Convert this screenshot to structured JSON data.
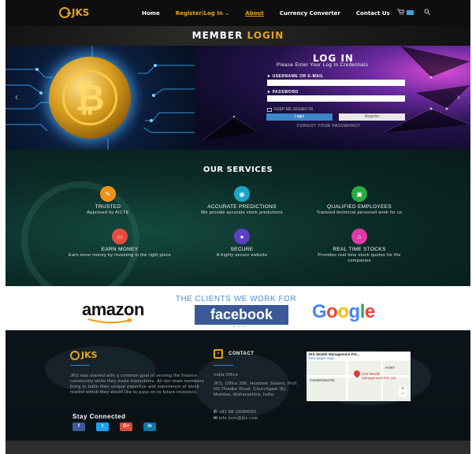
{
  "nav": {
    "logo": "JKS",
    "links": [
      "Home",
      "Register/Log In",
      "About",
      "Currency Converter",
      "Contact Us"
    ],
    "register_caret": "⌄"
  },
  "banner": {
    "title_white": "MEMBER",
    "title_gold": "LOGIN"
  },
  "login": {
    "title": "LOG IN",
    "subtitle": "Please Enter Your Log In Credentials",
    "username_label": "USERNAME OR E-MAIL",
    "password_label": "PASSWORD",
    "keep_signed": "KEEP ME SIGNED IN",
    "login_button": "Login",
    "register_button": "Register",
    "forgot": "FORGOT YOUR PASSWORD?"
  },
  "services": {
    "title": "OUR SERVICES",
    "items": [
      {
        "title": "TRUSTED",
        "desc": "Approved by AICTE",
        "color": "#f0921a"
      },
      {
        "title": "ACCURATE PREDICTIONS",
        "desc": "We provide accurate stock predictions",
        "color": "#1ba6c8"
      },
      {
        "title": "QUALIFIED EMPLOYEES",
        "desc": "Trainned technical personell work for us",
        "color": "#27ae3e"
      },
      {
        "title": "EARN MONEY",
        "desc": "Earn more money by investing in the right place",
        "color": "#e84c3d"
      },
      {
        "title": "SECURE",
        "desc": "A highly secure website",
        "color": "#5b3fc4"
      },
      {
        "title": "REAL TIME STOCKS",
        "desc": "Provides real time stock quotes for the companies",
        "color": "#e03aa9"
      }
    ]
  },
  "clients": {
    "title": "THE CLIENTS WE WORK FOR",
    "amazon": "amazon",
    "facebook": "facebook",
    "google": [
      "G",
      "o",
      "o",
      "g",
      "l",
      "e"
    ]
  },
  "footer": {
    "logo": "JKS",
    "about": "JKS was started with a common goal of serving the finance community while they make transctions. All our team members bring to table their unique expertise and experience of stock market which they would like to pass on to future investors.",
    "stay_connected": "Stay Connected",
    "social": [
      "f",
      "t",
      "G+",
      "in"
    ],
    "contact_title": "CONTACT",
    "office_label": "India Office",
    "address": "JKS, Office 206, Hustown Solaris, Prof. NS Phadke Road, Churchgate (E) Mumbai, Maharashtra, India",
    "phone": "+91 98 19284052",
    "email": "info.bsm@jks.com",
    "map_header": "JKS Wealth Management Pvt...",
    "map_sub": "View larger map",
    "map_labels": [
      "FORT",
      "CHURCHGATE",
      "JKS Wealth Management Pvt. Ltd"
    ]
  }
}
